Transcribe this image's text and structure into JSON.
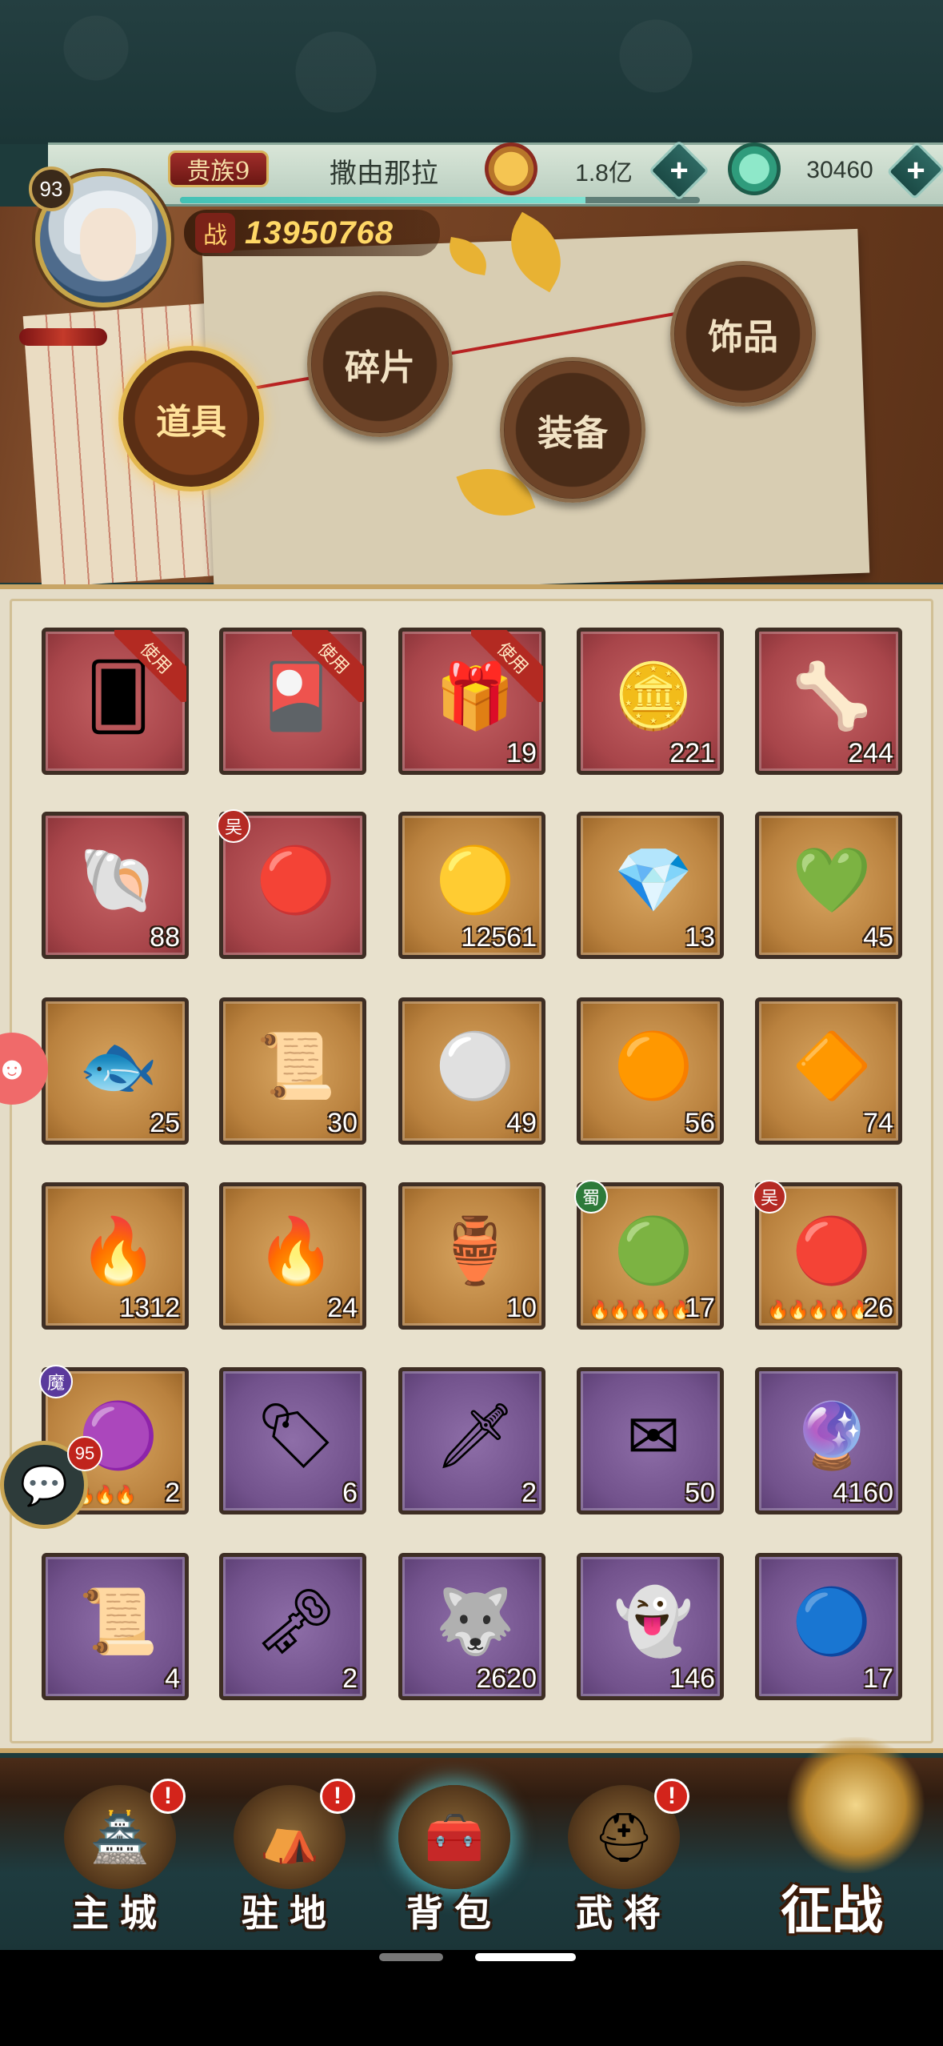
{
  "header": {
    "level": "93",
    "vip": "贵族9",
    "player_name": "撒由那拉",
    "gold": "1.8亿",
    "jade": "30460",
    "power_icon": "战",
    "power": "13950768",
    "xp_fraction": 0.78
  },
  "tabs": [
    {
      "label": "道具",
      "active": true
    },
    {
      "label": "碎片",
      "active": false
    },
    {
      "label": "装备",
      "active": false
    },
    {
      "label": "饰品",
      "active": false
    }
  ],
  "ribbon_label": "使用",
  "items": [
    {
      "name": "red-card-item",
      "bg": "red",
      "icon": "🂠",
      "count": "",
      "ribbon": true
    },
    {
      "name": "gold-card-item",
      "bg": "red",
      "icon": "🎴",
      "count": "",
      "ribbon": true
    },
    {
      "name": "gift-chest-item",
      "bg": "red",
      "icon": "🎁",
      "count": "19",
      "ribbon": true
    },
    {
      "name": "gold-coin-item",
      "bg": "red",
      "icon": "🪙",
      "count": "221"
    },
    {
      "name": "ivory-tusk-item",
      "bg": "red",
      "icon": "🦴",
      "count": "244"
    },
    {
      "name": "seashell-item",
      "bg": "red",
      "icon": "🐚",
      "count": "88"
    },
    {
      "name": "red-orb-item",
      "bg": "red",
      "icon": "🔴",
      "count": "",
      "faction": "吴",
      "faction_class": "wu"
    },
    {
      "name": "golden-pearl-item",
      "bg": "gold",
      "icon": "🟡",
      "count": "12561"
    },
    {
      "name": "red-crystal-item",
      "bg": "gold",
      "icon": "💎",
      "count": "13"
    },
    {
      "name": "green-crystal-item",
      "bg": "gold",
      "icon": "💚",
      "count": "45"
    },
    {
      "name": "blue-fish-item",
      "bg": "gold",
      "icon": "🐟",
      "count": "25"
    },
    {
      "name": "purple-cloth-item",
      "bg": "gold",
      "icon": "📜",
      "count": "30"
    },
    {
      "name": "jade-disc-item",
      "bg": "gold",
      "icon": "⚪",
      "count": "49"
    },
    {
      "name": "fire-orb-item",
      "bg": "gold",
      "icon": "🟠",
      "count": "56"
    },
    {
      "name": "amber-crystal-item",
      "bg": "gold",
      "icon": "🔶",
      "count": "74"
    },
    {
      "name": "green-flame-item",
      "bg": "gold",
      "icon": "🔥",
      "count": "1312"
    },
    {
      "name": "orange-flame-item",
      "bg": "gold",
      "icon": "🔥",
      "count": "24"
    },
    {
      "name": "wine-jar-item",
      "bg": "gold",
      "icon": "🏺",
      "count": "10"
    },
    {
      "name": "shu-orb-item",
      "bg": "gold",
      "icon": "🟢",
      "count": "17",
      "faction": "蜀",
      "faction_class": "shu",
      "stars": "🔥🔥🔥🔥🔥"
    },
    {
      "name": "wu-orb-item",
      "bg": "gold",
      "icon": "🔴",
      "count": "26",
      "faction": "吴",
      "faction_class": "wu",
      "stars": "🔥🔥🔥🔥🔥"
    },
    {
      "name": "mo-orb-item",
      "bg": "gold",
      "icon": "🟣",
      "count": "2",
      "faction": "魔",
      "faction_class": "mo",
      "stars": "🔥🔥🔥🔥"
    },
    {
      "name": "purple-token-item",
      "bg": "purple",
      "icon": "🏷",
      "count": "6"
    },
    {
      "name": "dart-item",
      "bg": "purple",
      "icon": "🗡",
      "count": "2"
    },
    {
      "name": "scroll-letter-item",
      "bg": "purple",
      "icon": "✉",
      "count": "50"
    },
    {
      "name": "armillary-item",
      "bg": "purple",
      "icon": "🔮",
      "count": "4160"
    },
    {
      "name": "golden-scroll-item",
      "bg": "purple",
      "icon": "📜",
      "count": "4"
    },
    {
      "name": "bronze-key-item",
      "bg": "purple",
      "icon": "🗝",
      "count": "2"
    },
    {
      "name": "beast-dagger-item",
      "bg": "purple",
      "icon": "🐺",
      "count": "2620"
    },
    {
      "name": "jade-spirit-item",
      "bg": "purple",
      "icon": "👻",
      "count": "146"
    },
    {
      "name": "blue-orb-item",
      "bg": "purple",
      "icon": "🔵",
      "count": "17"
    }
  ],
  "chat": {
    "unread": "95"
  },
  "nav": [
    {
      "label": "主城",
      "alert": true,
      "icon": "🏯"
    },
    {
      "label": "驻地",
      "alert": true,
      "icon": "⛺"
    },
    {
      "label": "背包",
      "alert": false,
      "icon": "🧰",
      "active": true
    },
    {
      "label": "武将",
      "alert": true,
      "icon": "⛑"
    }
  ],
  "campaign_label": "征战",
  "alert_glyph": "!"
}
